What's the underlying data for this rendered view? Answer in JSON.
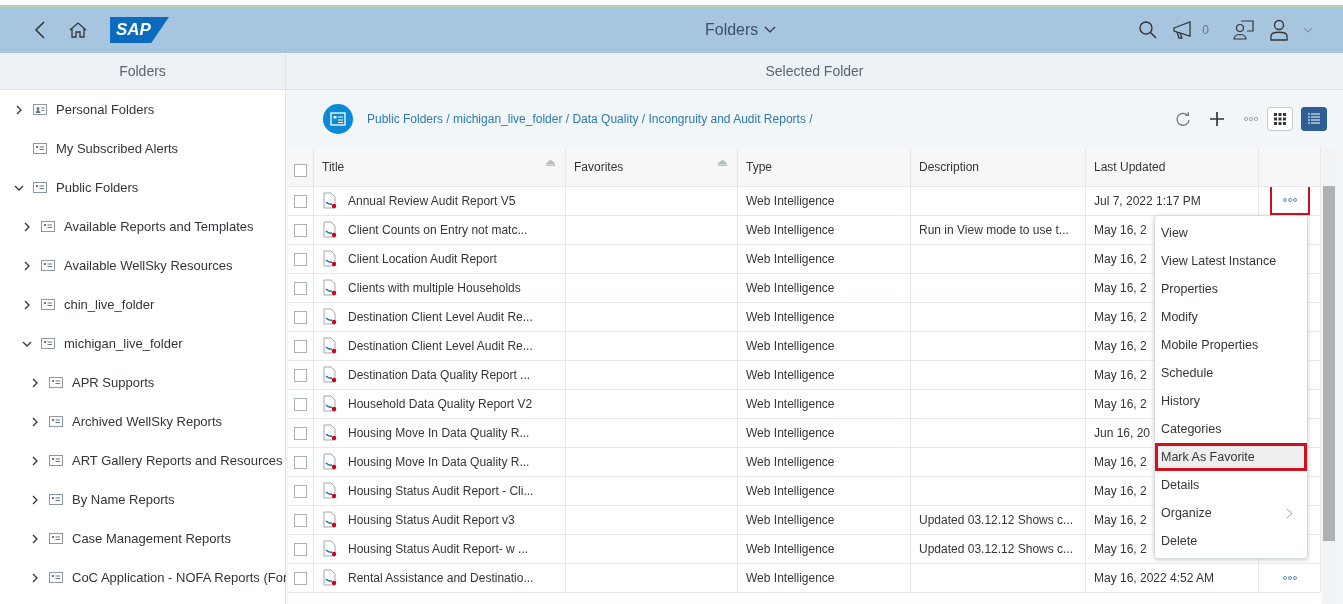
{
  "shell": {
    "logo": "SAP",
    "title": "Folders",
    "notification_count": "0"
  },
  "left_pane": {
    "heading": "Folders",
    "tree": [
      {
        "label": "Personal Folders",
        "kind": "personal",
        "expanded": false
      },
      {
        "label": "My Subscribed Alerts",
        "kind": "folder"
      },
      {
        "label": "Public Folders",
        "kind": "folder",
        "expanded": true,
        "children": [
          {
            "label": "Available Reports and Templates",
            "kind": "folder",
            "expanded": false
          },
          {
            "label": "Available WellSky Resources",
            "kind": "folder",
            "expanded": false
          },
          {
            "label": "chin_live_folder",
            "kind": "folder",
            "expanded": false
          },
          {
            "label": "michigan_live_folder",
            "kind": "folder",
            "expanded": true,
            "children": [
              {
                "label": "APR Supports",
                "kind": "folder",
                "expanded": false
              },
              {
                "label": "Archived WellSky Reports",
                "kind": "folder",
                "expanded": false
              },
              {
                "label": "ART Gallery Reports and Resources",
                "kind": "folder",
                "expanded": false
              },
              {
                "label": "By Name Reports",
                "kind": "folder",
                "expanded": false
              },
              {
                "label": "Case Management Reports",
                "kind": "folder",
                "expanded": false
              },
              {
                "label": "CoC Application - NOFA Reports (For",
                "kind": "folder",
                "expanded": false
              }
            ]
          }
        ]
      }
    ]
  },
  "right_pane": {
    "heading": "Selected Folder",
    "breadcrumb": "Public Folders / michigan_live_folder / Data Quality / Incongruity and Audit Reports /",
    "views": [
      {
        "kind": "grid",
        "selected": false
      },
      {
        "kind": "list",
        "selected": true
      }
    ],
    "table": {
      "header_checked": false,
      "columns": [
        {
          "label": "Title",
          "sortable": true
        },
        {
          "label": "Favorites",
          "sortable": true
        },
        {
          "label": "Type",
          "sortable": false
        },
        {
          "label": "Description",
          "sortable": false
        },
        {
          "label": "Last Updated",
          "sortable": false
        }
      ],
      "rows": [
        {
          "checked": false,
          "title": "Annual Review Audit Report V5",
          "type": "Web Intelligence",
          "last_updated": "Jul 7, 2022 1:17 PM",
          "actions_button": true,
          "highlighted": true
        },
        {
          "checked": false,
          "title": "Client Counts on Entry not matc...",
          "type": "Web Intelligence",
          "description": "Run in View mode to use t...",
          "last_updated": "May 16, 2"
        },
        {
          "checked": false,
          "title": "Client Location Audit Report",
          "type": "Web Intelligence",
          "last_updated": "May 16, 2"
        },
        {
          "checked": false,
          "title": "Clients with multiple Households",
          "type": "Web Intelligence",
          "last_updated": "May 16, 2"
        },
        {
          "checked": false,
          "title": "Destination Client Level Audit Re...",
          "type": "Web Intelligence",
          "last_updated": "May 16, 2"
        },
        {
          "checked": false,
          "title": "Destination Client Level Audit Re...",
          "type": "Web Intelligence",
          "last_updated": "May 16, 2"
        },
        {
          "checked": false,
          "title": "Destination Data Quality Report ...",
          "type": "Web Intelligence",
          "last_updated": "May 16, 2"
        },
        {
          "checked": false,
          "title": "Household Data Quality Report V2",
          "type": "Web Intelligence",
          "last_updated": "May 16, 2"
        },
        {
          "checked": false,
          "title": "Housing Move In Data Quality R...",
          "type": "Web Intelligence",
          "last_updated": "Jun 16, 20"
        },
        {
          "checked": false,
          "title": "Housing Move In Data Quality R...",
          "type": "Web Intelligence",
          "last_updated": "May 16, 2"
        },
        {
          "checked": false,
          "title": "Housing Status Audit Report - Cli...",
          "type": "Web Intelligence",
          "last_updated": "May 16, 2"
        },
        {
          "checked": false,
          "title": "Housing Status Audit Report v3",
          "type": "Web Intelligence",
          "description": "Updated 03.12.12 Shows c...",
          "last_updated": "May 16, 2"
        },
        {
          "checked": false,
          "title": "Housing Status Audit Report- w ...",
          "type": "Web Intelligence",
          "description": "Updated 03.12.12 Shows c...",
          "last_updated": "May 16, 2"
        },
        {
          "checked": false,
          "title": "Rental Assistance and Destinatio...",
          "type": "Web Intelligence",
          "last_updated": "May 16, 2022 4:52 AM",
          "actions_button": true,
          "highlighted": false
        }
      ]
    },
    "context_menu": [
      {
        "label": "View",
        "selected": false,
        "submenu": false
      },
      {
        "label": "View Latest Instance",
        "selected": false,
        "submenu": false
      },
      {
        "label": "Properties",
        "selected": false,
        "submenu": false
      },
      {
        "label": "Modify",
        "selected": false,
        "submenu": false
      },
      {
        "label": "Mobile Properties",
        "selected": false,
        "submenu": false
      },
      {
        "label": "Schedule",
        "selected": false,
        "submenu": false
      },
      {
        "label": "History",
        "selected": false,
        "submenu": false
      },
      {
        "label": "Categories",
        "selected": false,
        "submenu": false
      },
      {
        "label": "Mark As Favorite",
        "selected": true,
        "submenu": false
      },
      {
        "label": "Details",
        "selected": false,
        "submenu": false
      },
      {
        "label": "Organize",
        "selected": false,
        "submenu": true
      },
      {
        "label": "Delete",
        "selected": false,
        "submenu": false
      }
    ]
  }
}
